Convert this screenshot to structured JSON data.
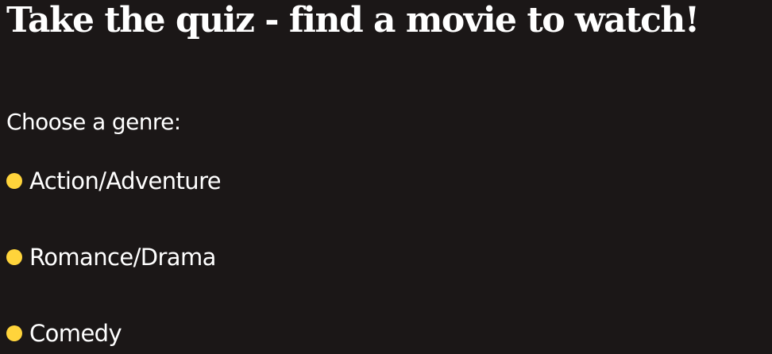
{
  "page": {
    "title": "Take the quiz - find a movie to watch!",
    "background_color": "#1b1717",
    "text_color": "#ffffff"
  },
  "quiz": {
    "question_label": "Choose a genre:",
    "radio_color": "#ffd43b",
    "options": [
      {
        "label": "Action/Adventure",
        "icon": "radio-dot"
      },
      {
        "label": "Romance/Drama",
        "icon": "radio-dot"
      },
      {
        "label": "Comedy",
        "icon": "radio-dot"
      }
    ]
  }
}
